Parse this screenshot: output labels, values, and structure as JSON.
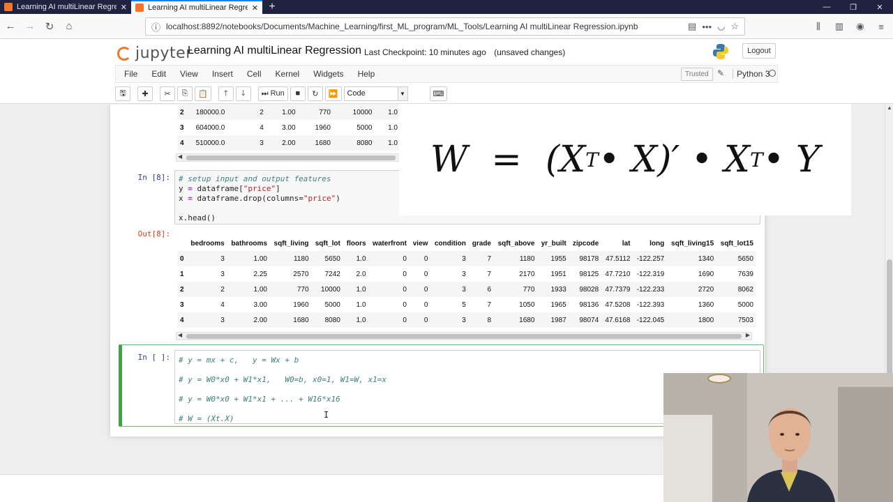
{
  "browser": {
    "tabs": [
      {
        "title": "Learning AI multiLinear Regres",
        "close": "✕"
      },
      {
        "title": "Learning AI multiLinear Regres",
        "close": "✕"
      }
    ],
    "new_tab": "+",
    "url": "localhost:8892/notebooks/Documents/Machine_Learning/first_ML_program/ML_Tools/Learning AI multiLinear Regression.ipynb"
  },
  "jupyter": {
    "brand": "jupyter",
    "notebook_title": "Learning AI multiLinear Regression",
    "checkpoint": "Last Checkpoint: 10 minutes ago",
    "unsaved": "(unsaved changes)",
    "logout": "Logout",
    "menus": [
      "File",
      "Edit",
      "View",
      "Insert",
      "Cell",
      "Kernel",
      "Widgets",
      "Help"
    ],
    "trusted": "Trusted",
    "kernel": "Python 3",
    "run_label": "Run",
    "cell_type": "Code"
  },
  "top_table": {
    "rows": [
      [
        "2",
        "180000.0",
        "2",
        "1.00",
        "770",
        "10000",
        "1.0"
      ],
      [
        "3",
        "604000.0",
        "4",
        "3.00",
        "1960",
        "5000",
        "1.0"
      ],
      [
        "4",
        "510000.0",
        "3",
        "2.00",
        "1680",
        "8080",
        "1.0"
      ]
    ]
  },
  "cell8": {
    "in_prompt": "In [8]:",
    "out_prompt": "Out[8]:",
    "code": {
      "l1_comment": "# setup input and output features",
      "l2_a": "y ",
      "l2_eq": "=",
      "l2_b": " dataframe[",
      "l2_str": "\"price\"",
      "l2_c": "]",
      "l3_a": "x ",
      "l3_eq": "=",
      "l3_b": " dataframe.drop(columns=",
      "l3_str": "\"price\"",
      "l3_c": ")",
      "l5": "x.head()"
    }
  },
  "out_table": {
    "columns": [
      "",
      "bedrooms",
      "bathrooms",
      "sqft_living",
      "sqft_lot",
      "floors",
      "waterfront",
      "view",
      "condition",
      "grade",
      "sqft_above",
      "yr_built",
      "zipcode",
      "lat",
      "long",
      "sqft_living15",
      "sqft_lot15"
    ],
    "rows": [
      [
        "0",
        "3",
        "1.00",
        "1180",
        "5650",
        "1.0",
        "0",
        "0",
        "3",
        "7",
        "1180",
        "1955",
        "98178",
        "47.5112",
        "-122.257",
        "1340",
        "5650"
      ],
      [
        "1",
        "3",
        "2.25",
        "2570",
        "7242",
        "2.0",
        "0",
        "0",
        "3",
        "7",
        "2170",
        "1951",
        "98125",
        "47.7210",
        "-122.319",
        "1690",
        "7639"
      ],
      [
        "2",
        "2",
        "1.00",
        "770",
        "10000",
        "1.0",
        "0",
        "0",
        "3",
        "6",
        "770",
        "1933",
        "98028",
        "47.7379",
        "-122.233",
        "2720",
        "8062"
      ],
      [
        "3",
        "4",
        "3.00",
        "1960",
        "5000",
        "1.0",
        "0",
        "0",
        "5",
        "7",
        "1050",
        "1965",
        "98136",
        "47.5208",
        "-122.393",
        "1360",
        "5000"
      ],
      [
        "4",
        "3",
        "2.00",
        "1680",
        "8080",
        "1.0",
        "0",
        "0",
        "3",
        "8",
        "1680",
        "1987",
        "98074",
        "47.6168",
        "-122.045",
        "1800",
        "7503"
      ]
    ]
  },
  "active_cell": {
    "in_prompt": "In [ ]:",
    "lines": [
      "# y = mx + c,   y = Wx + b",
      "# y = W0*x0 + W1*x1,   W0=b, x0=1, W1=W, x1=x",
      "# y = W0*x0 + W1*x1 + ... + W16*x16",
      "# W = (Xt.X)"
    ]
  },
  "formula": {
    "lhs": "W",
    "equals": "=",
    "open": "(X",
    "sup1": "T",
    "dot1": " • X)′ • X",
    "sup2": "T",
    "tail": " • Y"
  }
}
